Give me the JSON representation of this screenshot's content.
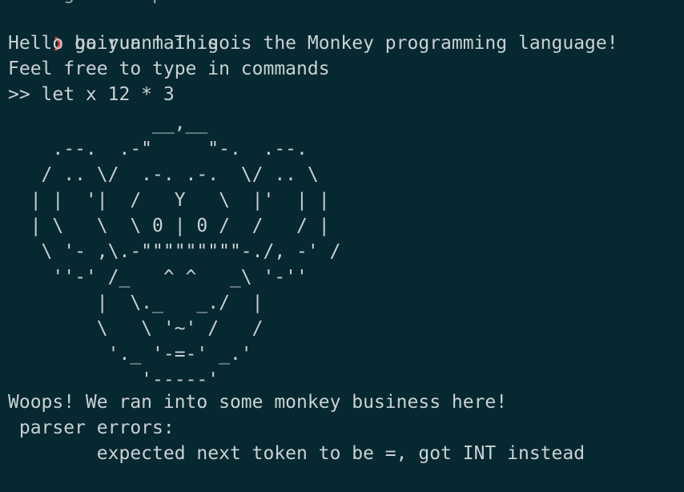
{
  "terminal": {
    "top_partial_line": "     g       p",
    "prompt_symbol": "❯",
    "command": "go run main.go",
    "greeting": "Hello baiyuan! This is the Monkey programming language!",
    "instructions": "Feel free to type in commands",
    "repl_input": ">> let x 12 * 3",
    "monkey_ascii": "             __,__\n    .--.  .-\"     \"-.  .--.\n   / .. \\/  .-. .-.  \\/ .. \\\n  | |  '|  /   Y   \\  |'  | |\n  | \\   \\  \\ 0 | 0 /  /   / |\n   \\ '- ,\\.-\"\"\"\"\"\"\"\"\"-./, -' /\n    ''-' /_   ^ ^   _\\ '-''\n        |  \\._   _./  |\n        \\   \\ '~' /   /\n         '._ '-=-' _.'\n            '-----'",
    "error_title": "Woops! We ran into some monkey business here!",
    "error_subtitle": " parser errors:",
    "error_detail": "\texpected next token to be =, got INT instead",
    "final_prompt": ">>"
  },
  "colors": {
    "background": "#062830",
    "text": "#c9d1d3",
    "prompt_arrow": "#e8443a",
    "cursor": "#8e9a9d"
  }
}
